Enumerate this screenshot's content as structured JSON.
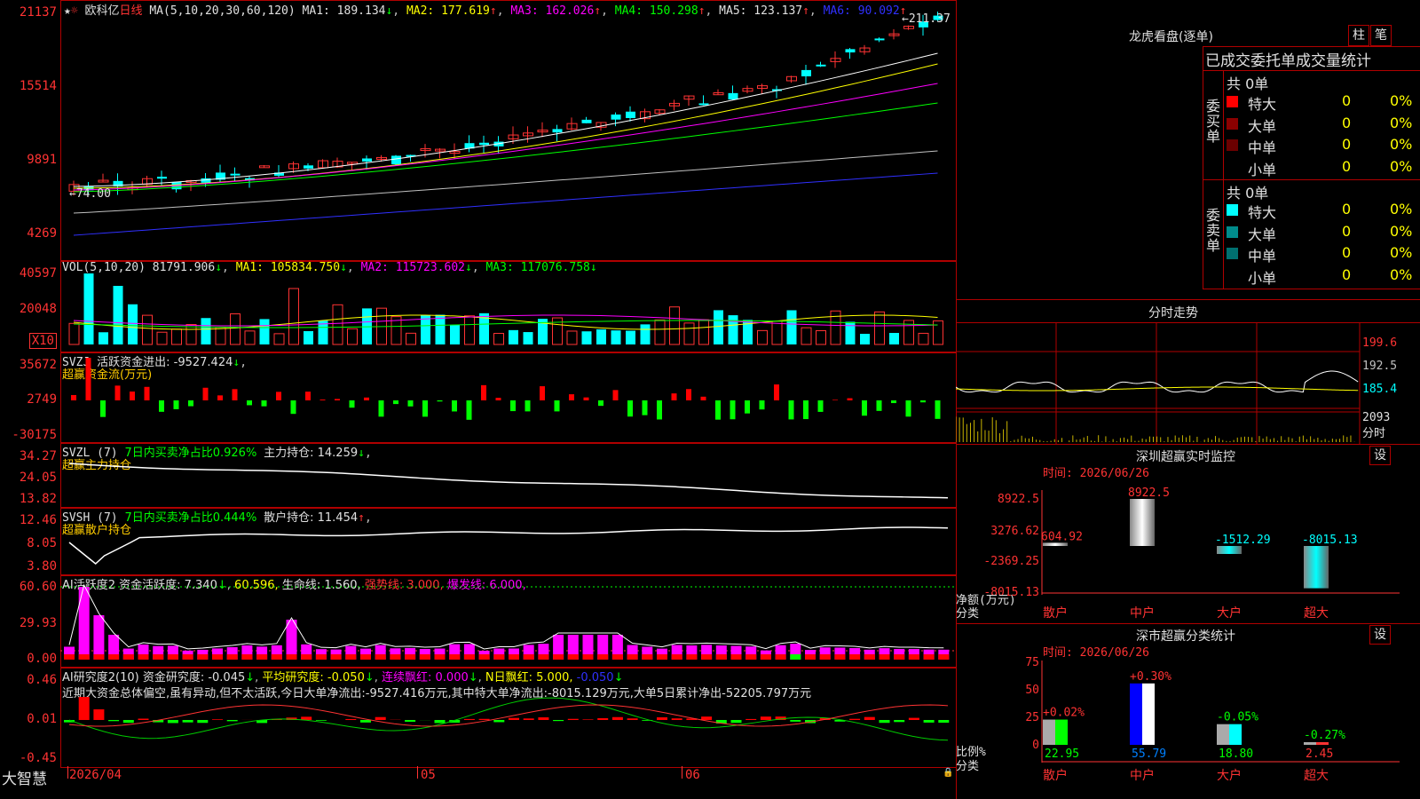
{
  "stock_name": "欧科亿",
  "period": "日线",
  "main_chart": {
    "ma_header": "MA(5,10,20,30,60,120)",
    "ma1": "MA1: 189.134",
    "ma2": "MA2: 177.619",
    "ma3": "MA3: 162.026",
    "ma4": "MA4: 150.298",
    "ma5": "MA5: 123.137",
    "ma6": "MA6: 90.092",
    "y_labels": [
      "21137",
      "15514",
      "9891",
      "4269"
    ],
    "high_marker": "211.37",
    "low_marker": "74.00"
  },
  "vol_chart": {
    "header": "VOL(5,10,20)",
    "value": "81791.906",
    "ma1": "MA1: 105834.750",
    "ma2": "MA2: 115723.602",
    "ma3": "MA3: 117076.758",
    "y_labels": [
      "40597",
      "20048"
    ],
    "unit": "X10"
  },
  "svzj": {
    "header": "SVZJ",
    "label": "活跃资金进出: -9527.424",
    "title": "超赢资金流(万元)",
    "y_labels": [
      "35672",
      "2749",
      "-30175"
    ]
  },
  "svzl": {
    "header": "SVZL (7)",
    "net": "7日内买卖净占比0.926%",
    "hold": "主力持仓: 14.259",
    "title": "超赢主力持仓",
    "y_labels": [
      "34.27",
      "24.05",
      "13.82"
    ]
  },
  "svsh": {
    "header": "SVSH (7)",
    "net": "7日内买卖净占比0.444%",
    "hold": "散户持仓: 11.454",
    "title": "超赢散户持仓",
    "y_labels": [
      "12.46",
      "8.05",
      "3.80"
    ]
  },
  "ai_active": {
    "header": "AI活跃度2",
    "funds": "资金活跃度: 7.340",
    "v2": "60.596,",
    "life": "生命线: 1.560,",
    "strong": "强势线: 3.000,",
    "burst": "爆发线: 6.000,",
    "y_labels": [
      "60.60",
      "29.93",
      "0.00"
    ]
  },
  "ai_research": {
    "header": "AI研究度2(10)",
    "funds": "资金研究度: -0.045",
    "avg": "平均研究度: -0.050",
    "streak": "连续飘红: 0.000",
    "nday": "N日飘红: 5.000,",
    "neg": "-0.050",
    "comment": "近期大资金总体偏空,虽有异动,但不太活跃,今日大单净流出:-9527.416万元,其中特大单净流出:-8015.129万元,大单5日累计净出-52205.797万元",
    "y_labels": [
      "0.46",
      "0.01",
      "-0.45"
    ]
  },
  "x_axis": [
    "2026/04",
    "05",
    "06"
  ],
  "brand": "大智慧",
  "right_panel": {
    "dragon_title": "龙虎看盘(逐单)",
    "btn_bar": "柱",
    "btn_pen": "笔",
    "stats_title": "已成交委托单成交量统计",
    "buy_group": "委买单",
    "sell_group": "委卖单",
    "buy_total": "共 0单",
    "sell_total": "共 0单",
    "buy_rows": [
      {
        "label": "特大",
        "count": "0",
        "pct": "0%",
        "color": "#ff0000"
      },
      {
        "label": "大单",
        "count": "0",
        "pct": "0%",
        "color": "#8b0000"
      },
      {
        "label": "中单",
        "count": "0",
        "pct": "0%",
        "color": "#6b0000"
      },
      {
        "label": "小单",
        "count": "0",
        "pct": "0%",
        "color": ""
      }
    ],
    "sell_rows": [
      {
        "label": "特大",
        "count": "0",
        "pct": "0%",
        "color": "#00ffff"
      },
      {
        "label": "大单",
        "count": "0",
        "pct": "0%",
        "color": "#008b8b"
      },
      {
        "label": "中单",
        "count": "0",
        "pct": "0%",
        "color": "#007070"
      },
      {
        "label": "小单",
        "count": "0",
        "pct": "0%",
        "color": ""
      }
    ],
    "intraday_title": "分时走势",
    "intraday_labels": [
      "199.6",
      "192.5",
      "185.4",
      "2093",
      "分时"
    ],
    "monitor_title": "深圳超赢实时监控",
    "set_btn": "设",
    "monitor_time": "时间: 2026/06/26",
    "monitor_y": [
      "8922.5",
      "3276.62",
      "-2369.25",
      "-8015.13"
    ],
    "monitor_unit": "净额(万元)",
    "monitor_cls": "分类",
    "monitor_bars": [
      {
        "cat": "散户",
        "value": "604.92"
      },
      {
        "cat": "中户",
        "value": "8922.5"
      },
      {
        "cat": "大户",
        "value": "-1512.29"
      },
      {
        "cat": "超大",
        "value": "-8015.13"
      }
    ],
    "stats2_title": "深市超赢分类统计",
    "stats2_time": "时间: 2026/06/26",
    "stats2_y": [
      "75",
      "50",
      "25",
      "0"
    ],
    "stats2_unit": "比例%",
    "stats2_cls": "分类",
    "stats2_bars": [
      {
        "cat": "散户",
        "chg": "+0.02%",
        "val": "22.95"
      },
      {
        "cat": "中户",
        "chg": "+0.30%",
        "val": "55.79"
      },
      {
        "cat": "大户",
        "chg": "-0.05%",
        "val": "18.80"
      },
      {
        "cat": "超大",
        "chg": "-0.27%",
        "val": "2.45"
      }
    ]
  }
}
